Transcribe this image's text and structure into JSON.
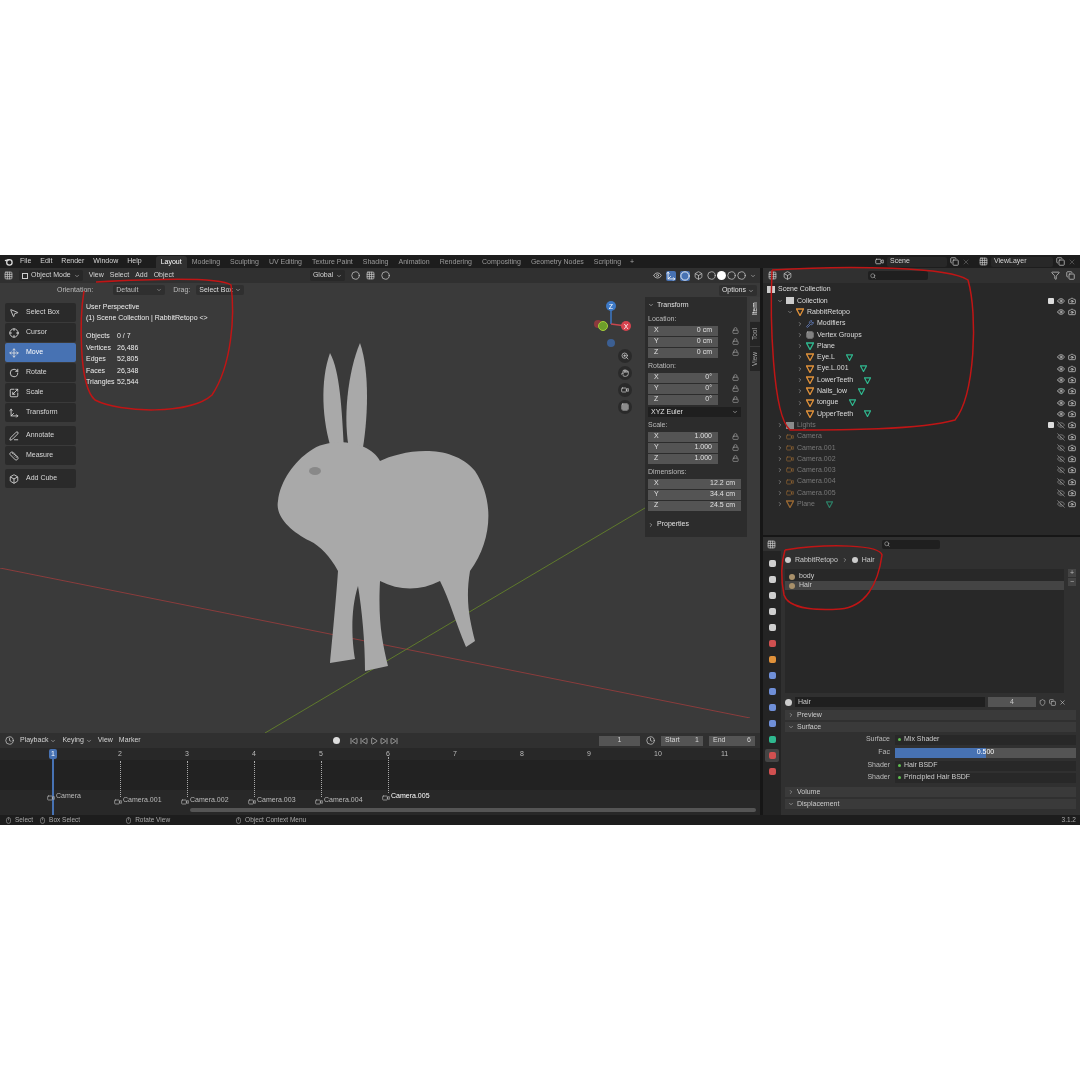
{
  "menu": [
    "File",
    "Edit",
    "Render",
    "Window",
    "Help"
  ],
  "workspaces": [
    {
      "label": "Layout",
      "selected": true
    },
    {
      "label": "Modeling",
      "selected": false
    },
    {
      "label": "Sculpting",
      "selected": false
    },
    {
      "label": "UV Editing",
      "selected": false
    },
    {
      "label": "Texture Paint",
      "selected": false
    },
    {
      "label": "Shading",
      "selected": false
    },
    {
      "label": "Animation",
      "selected": false
    },
    {
      "label": "Rendering",
      "selected": false
    },
    {
      "label": "Compositing",
      "selected": false
    },
    {
      "label": "Geometry Nodes",
      "selected": false
    },
    {
      "label": "Scripting",
      "selected": false
    }
  ],
  "add_workspace": "+",
  "scene": "Scene",
  "view_layer": "ViewLayer",
  "viewport_header": {
    "mode": "Object Mode",
    "menus": [
      "View",
      "Select",
      "Add",
      "Object"
    ],
    "orientation": "Global",
    "options": "Options"
  },
  "tool_settings": {
    "orientation_label": "Orientation:",
    "orientation": "Default",
    "drag_label": "Drag:",
    "drag": "Select Box"
  },
  "toolbar_groups": [
    {
      "tools": [
        {
          "label": "Select Box",
          "kind": "select",
          "selected": false
        },
        {
          "label": "Cursor",
          "kind": "cursor",
          "selected": false
        },
        {
          "label": "Move",
          "kind": "move",
          "selected": true
        },
        {
          "label": "Rotate",
          "kind": "rotate",
          "selected": false
        },
        {
          "label": "Scale",
          "kind": "scale",
          "selected": false
        },
        {
          "label": "Transform",
          "kind": "transform",
          "selected": false
        }
      ]
    },
    {
      "tools": [
        {
          "label": "Annotate",
          "kind": "annotate",
          "selected": false
        },
        {
          "label": "Measure",
          "kind": "measure",
          "selected": false
        }
      ]
    },
    {
      "tools": [
        {
          "label": "Add Cube",
          "kind": "cube",
          "selected": false
        }
      ]
    }
  ],
  "overlay": {
    "lines": [
      "User Perspective",
      "(1) Scene Collection | RabbitRetopo <>"
    ],
    "stats": [
      {
        "label": "Objects",
        "value": "0 / 7"
      },
      {
        "label": "Vertices",
        "value": "26,486"
      },
      {
        "label": "Edges",
        "value": "52,805"
      },
      {
        "label": "Faces",
        "value": "26,348"
      },
      {
        "label": "Triangles",
        "value": "52,544"
      }
    ]
  },
  "gizmo_labels": [
    "Z",
    "X"
  ],
  "n_panel": {
    "tabs": [
      {
        "label": "Item",
        "selected": true
      },
      {
        "label": "Tool",
        "selected": false
      },
      {
        "label": "View",
        "selected": false
      }
    ],
    "title": "Transform",
    "groups": [
      {
        "label": "Location:",
        "locks": true,
        "rows": [
          {
            "axis": "X",
            "value": "0 cm"
          },
          {
            "axis": "Y",
            "value": "0 cm"
          },
          {
            "axis": "Z",
            "value": "0 cm"
          }
        ]
      },
      {
        "label": "Rotation:",
        "locks": true,
        "rows": [
          {
            "axis": "X",
            "value": "0°"
          },
          {
            "axis": "Y",
            "value": "0°"
          },
          {
            "axis": "Z",
            "value": "0°"
          }
        ],
        "mode": "XYZ Euler"
      },
      {
        "label": "Scale:",
        "locks": true,
        "rows": [
          {
            "axis": "X",
            "value": "1.000"
          },
          {
            "axis": "Y",
            "value": "1.000"
          },
          {
            "axis": "Z",
            "value": "1.000"
          }
        ]
      },
      {
        "label": "Dimensions:",
        "locks": false,
        "rows": [
          {
            "axis": "X",
            "value": "12.2 cm"
          },
          {
            "axis": "Y",
            "value": "34.4 cm"
          },
          {
            "axis": "Z",
            "value": "24.5 cm"
          }
        ]
      }
    ],
    "properties": "Properties"
  },
  "timeline": {
    "menus": [
      "Playback",
      "Keying",
      "View",
      "Marker"
    ],
    "current_frame": "1",
    "start_label": "Start",
    "start": "1",
    "end_label": "End",
    "end": "6",
    "frames": [
      "1",
      "2",
      "3",
      "4",
      "5",
      "6",
      "7",
      "8",
      "9",
      "10",
      "11"
    ],
    "markers": [
      "Camera",
      "Camera.001",
      "Camera.002",
      "Camera.003",
      "Camera.004",
      "Camera.005"
    ]
  },
  "outliner": {
    "tree": [
      {
        "label": "Scene Collection",
        "kind": "scene_collection",
        "disabled": false,
        "children": [
          {
            "label": "Collection",
            "kind": "collection",
            "expanded": true,
            "disabled": false,
            "checked": true,
            "visible": true,
            "children": [
              {
                "label": "RabbitRetopo",
                "kind": "mesh_object",
                "expanded": true,
                "disabled": false,
                "visible": true,
                "children": [
                  {
                    "label": "Modifiers",
                    "kind": "modifiers",
                    "expanded": false,
                    "disabled": false
                  },
                  {
                    "label": "Vertex Groups",
                    "kind": "vertex_groups",
                    "expanded": false,
                    "disabled": false
                  },
                  {
                    "label": "Plane",
                    "kind": "particles",
                    "expanded": false,
                    "disabled": false
                  },
                  {
                    "label": "Eye.L",
                    "kind": "mesh_child",
                    "expanded": false,
                    "disabled": false,
                    "visible": true
                  },
                  {
                    "label": "Eye.L.001",
                    "kind": "mesh_child",
                    "expanded": false,
                    "disabled": false,
                    "visible": true
                  },
                  {
                    "label": "LowerTeeth",
                    "kind": "mesh_child",
                    "expanded": false,
                    "disabled": false,
                    "visible": true
                  },
                  {
                    "label": "Nails_low",
                    "kind": "mesh_child",
                    "expanded": false,
                    "disabled": false,
                    "visible": true
                  },
                  {
                    "label": "tongue",
                    "kind": "mesh_child",
                    "expanded": false,
                    "disabled": false,
                    "visible": true
                  },
                  {
                    "label": "UpperTeeth",
                    "kind": "mesh_child",
                    "expanded": false,
                    "disabled": false,
                    "visible": true
                  }
                ]
              }
            ]
          },
          {
            "label": "Lights",
            "kind": "collection",
            "expanded": false,
            "disabled": true,
            "checked": true,
            "visible": false
          },
          {
            "label": "Camera",
            "kind": "camera",
            "expanded": false,
            "disabled": true,
            "visible": false
          },
          {
            "label": "Camera.001",
            "kind": "camera",
            "expanded": false,
            "disabled": true,
            "visible": false
          },
          {
            "label": "Camera.002",
            "kind": "camera",
            "expanded": false,
            "disabled": true,
            "visible": false
          },
          {
            "label": "Camera.003",
            "kind": "camera",
            "expanded": false,
            "disabled": true,
            "visible": false
          },
          {
            "label": "Camera.004",
            "kind": "camera",
            "expanded": false,
            "disabled": true,
            "visible": false
          },
          {
            "label": "Camera.005",
            "kind": "camera",
            "expanded": false,
            "disabled": true,
            "visible": false
          },
          {
            "label": "Plane",
            "kind": "mesh_child",
            "expanded": false,
            "disabled": true,
            "visible": false
          }
        ]
      }
    ]
  },
  "properties": {
    "tabs": [
      {
        "kind": "tool",
        "selected": false
      },
      {
        "kind": "render",
        "selected": false
      },
      {
        "kind": "output",
        "selected": false
      },
      {
        "kind": "view_layer",
        "selected": false
      },
      {
        "kind": "scene",
        "selected": false
      },
      {
        "kind": "world",
        "selected": false
      },
      {
        "kind": "object",
        "selected": false
      },
      {
        "kind": "modifiers",
        "selected": false
      },
      {
        "kind": "particles",
        "selected": false
      },
      {
        "kind": "physics",
        "selected": false
      },
      {
        "kind": "constraints",
        "selected": false
      },
      {
        "kind": "data",
        "selected": false
      },
      {
        "kind": "material",
        "selected": true
      },
      {
        "kind": "texture",
        "selected": false
      }
    ],
    "breadcrumb": [
      "RabbitRetopo",
      "Hair"
    ],
    "slots": [
      {
        "label": "body",
        "selected": false
      },
      {
        "label": "Hair",
        "selected": true
      }
    ],
    "slot_buttons": [
      "+",
      "−"
    ],
    "material_name": "Hair",
    "users": "4",
    "panels": [
      {
        "label": "Preview",
        "expanded": false
      },
      {
        "label": "Surface",
        "expanded": true,
        "rows": [
          {
            "label": "Surface",
            "value": "Mix Shader",
            "kind": "node"
          },
          {
            "label": "Fac",
            "value": "0.500",
            "kind": "slider",
            "level": 0.5
          },
          {
            "label": "Shader",
            "value": "Hair BSDF",
            "kind": "node"
          },
          {
            "label": "Shader",
            "value": "Principled Hair BSDF",
            "kind": "node"
          }
        ]
      },
      {
        "label": "Volume",
        "expanded": false
      },
      {
        "label": "Displacement",
        "expanded": true
      }
    ]
  },
  "status_bar": {
    "items": [
      "Select",
      "Box Select",
      "Rotate View",
      "Object Context Menu"
    ],
    "version": "3.1.2"
  }
}
